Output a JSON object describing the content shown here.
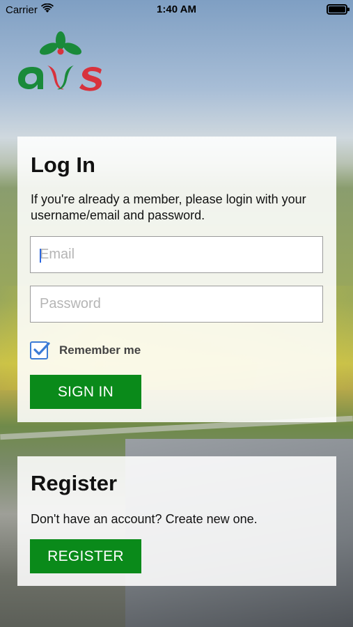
{
  "status_bar": {
    "carrier": "Carrier",
    "time": "1:40 AM"
  },
  "login": {
    "title": "Log In",
    "description": "If you're already a member, please login with your username/email and password.",
    "email_placeholder": "Email",
    "email_value": "",
    "password_placeholder": "Password",
    "password_value": "",
    "remember_label": "Remember me",
    "remember_checked": true,
    "signin_label": "SIGN IN"
  },
  "register": {
    "title": "Register",
    "description": "Don't have an account? Create new one.",
    "register_label": "REGISTER"
  },
  "colors": {
    "button_green": "#0a8a1a",
    "checkbox_blue": "#3b7bd6",
    "logo_green": "#1a8a3a",
    "logo_red": "#d8323c"
  },
  "icons": [
    "wifi-icon",
    "battery-icon",
    "checkmark-icon",
    "brand-logo"
  ]
}
